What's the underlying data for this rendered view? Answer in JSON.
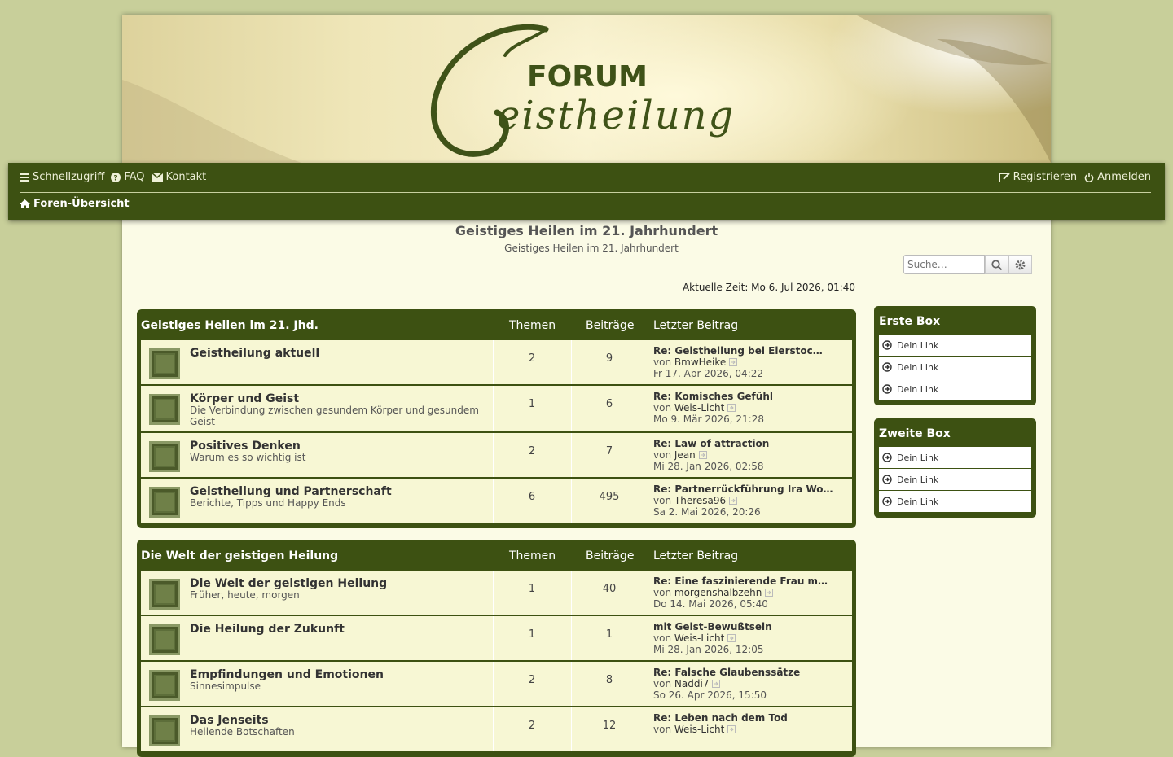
{
  "banner": {
    "logo_forum": "FORUM",
    "logo_script": "Geistheilung"
  },
  "nav": {
    "quick": "Schnellzugriff",
    "faq": "FAQ",
    "contact": "Kontakt",
    "register": "Registrieren",
    "login": "Anmelden",
    "breadcrumb": "Foren-Übersicht"
  },
  "site": {
    "title": "Geistiges Heilen im 21. Jahrhundert",
    "description": "Geistiges Heilen im 21. Jahrhundert"
  },
  "search": {
    "placeholder": "Suche…"
  },
  "time": "Aktuelle Zeit: Mo 6. Jul 2026, 01:40",
  "columns": {
    "topics": "Themen",
    "posts": "Beiträge",
    "last": "Letzter Beitrag"
  },
  "categories": [
    {
      "title": "Geistiges Heilen im 21. Jhd.",
      "forums": [
        {
          "name": "Geistheilung aktuell",
          "desc": "",
          "topics": "2",
          "posts": "9",
          "last_subject": "Re: Geistheilung bei Eierstoc…",
          "by": "von",
          "user": "BmwHeike",
          "date": "Fr 17. Apr 2026, 04:22"
        },
        {
          "name": "Körper und Geist",
          "desc": "Die Verbindung zwischen gesundem Körper und gesundem Geist",
          "topics": "1",
          "posts": "6",
          "last_subject": "Re: Komisches Gefühl",
          "by": "von",
          "user": "Weis-Licht",
          "date": "Mo 9. Mär 2026, 21:28"
        },
        {
          "name": "Positives Denken",
          "desc": "Warum es so wichtig ist",
          "topics": "2",
          "posts": "7",
          "last_subject": "Re: Law of attraction",
          "by": "von",
          "user": "Jean",
          "date": "Mi 28. Jan 2026, 02:58"
        },
        {
          "name": "Geistheilung und Partnerschaft",
          "desc": "Berichte, Tipps und Happy Ends",
          "topics": "6",
          "posts": "495",
          "last_subject": "Re: Partnerrückführung Ira Wo…",
          "by": "von",
          "user": "Theresa96",
          "date": "Sa 2. Mai 2026, 20:26"
        }
      ]
    },
    {
      "title": "Die Welt der geistigen Heilung",
      "forums": [
        {
          "name": "Die Welt der geistigen Heilung",
          "desc": "Früher, heute, morgen",
          "topics": "1",
          "posts": "40",
          "last_subject": "Re: Eine faszinierende Frau m…",
          "by": "von",
          "user": "morgenshalbzehn",
          "date": "Do 14. Mai 2026, 05:40"
        },
        {
          "name": "Die Heilung der Zukunft",
          "desc": "",
          "topics": "1",
          "posts": "1",
          "last_subject": "mit Geist-Bewußtsein",
          "by": "von",
          "user": "Weis-Licht",
          "date": "Mi 28. Jan 2026, 12:05"
        },
        {
          "name": "Empfindungen und Emotionen",
          "desc": "Sinnesimpulse",
          "topics": "2",
          "posts": "8",
          "last_subject": "Re: Falsche Glaubenssätze",
          "by": "von",
          "user": "Naddi7",
          "date": "So 26. Apr 2026, 15:50"
        },
        {
          "name": "Das Jenseits",
          "desc": "Heilende Botschaften",
          "topics": "2",
          "posts": "12",
          "last_subject": "Re: Leben nach dem Tod",
          "by": "von",
          "user": "Weis-Licht",
          "date": ""
        }
      ]
    }
  ],
  "sidebar": [
    {
      "title": "Erste Box",
      "links": [
        "Dein Link",
        "Dein Link",
        "Dein Link"
      ]
    },
    {
      "title": "Zweite Box",
      "links": [
        "Dein Link",
        "Dein Link",
        "Dein Link"
      ]
    }
  ]
}
